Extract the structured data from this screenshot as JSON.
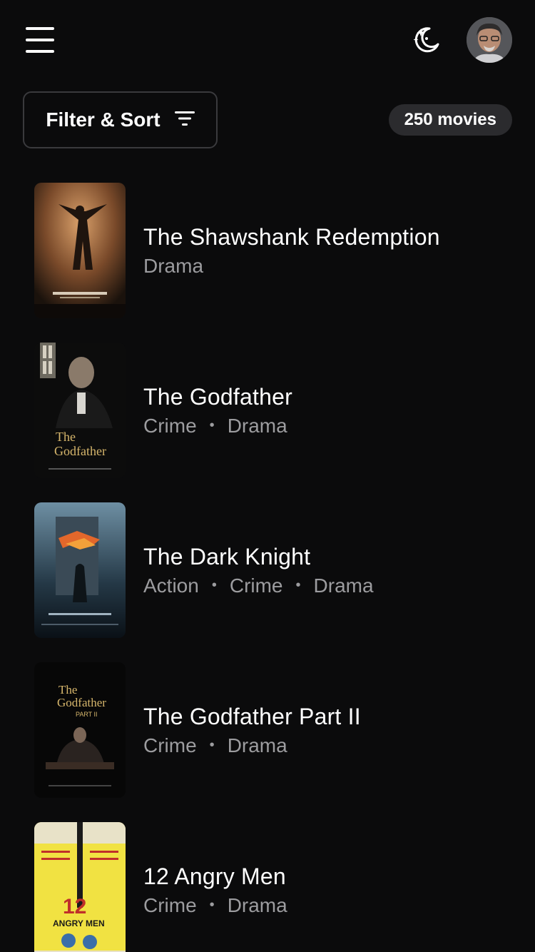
{
  "header": {
    "menu_icon": "hamburger-menu-icon",
    "theme_icon": "moon-stars-icon",
    "avatar_icon": "user-avatar"
  },
  "controls": {
    "filter_label": "Filter & Sort",
    "filter_icon": "filter-lines-icon",
    "count_label": "250 movies"
  },
  "movies": [
    {
      "title": "The Shawshank Redemption",
      "genres": [
        "Drama"
      ]
    },
    {
      "title": "The Godfather",
      "genres": [
        "Crime",
        "Drama"
      ]
    },
    {
      "title": "The Dark Knight",
      "genres": [
        "Action",
        "Crime",
        "Drama"
      ]
    },
    {
      "title": "The Godfather Part II",
      "genres": [
        "Crime",
        "Drama"
      ]
    },
    {
      "title": "12 Angry Men",
      "genres": [
        "Crime",
        "Drama"
      ]
    }
  ],
  "colors": {
    "background": "#0b0b0c",
    "text_primary": "#ffffff",
    "text_secondary": "#9c9c9f",
    "badge_bg": "#2b2b2e",
    "border": "#3a3a3d"
  }
}
